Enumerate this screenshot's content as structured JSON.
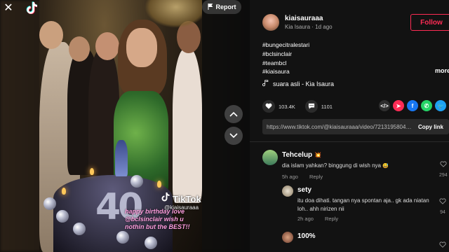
{
  "window": {
    "close_icon": "close-icon",
    "logo_icon": "tiktok-logo-icon"
  },
  "report": {
    "label": "Report",
    "icon": "flag-icon"
  },
  "video": {
    "overlay_brand": "TikTok",
    "overlay_handle": "@kiaisauraaa",
    "overlay_caption": "happy birthday love @bclsinclair wish u nothin but the BEST!!",
    "cake_number": "40"
  },
  "nav": {
    "prev_icon": "chevron-up-icon",
    "next_icon": "chevron-down-icon"
  },
  "author": {
    "username": "kiaisauraaa",
    "display_name": "Kia Isaura",
    "posted": "1d ago",
    "follow_label": "Follow"
  },
  "hashtags": [
    "#bungecitralestari",
    "#bclsinclair",
    "#teambcl",
    "#kiaisaura"
  ],
  "more_label": "more",
  "sound": {
    "icon": "music-note-icon",
    "label": "suara asli - Kia Isaura"
  },
  "stats": {
    "likes": "103.4K",
    "comments": "1101"
  },
  "share": [
    {
      "icon": "embed-icon",
      "glyph": "</>",
      "color": "#2f2f2f"
    },
    {
      "icon": "send-icon",
      "glyph": "➤",
      "color": "#fe2c55"
    },
    {
      "icon": "facebook-icon",
      "glyph": "f",
      "color": "#1877f2"
    },
    {
      "icon": "whatsapp-icon",
      "glyph": "✆",
      "color": "#25d366"
    },
    {
      "icon": "twitter-icon",
      "glyph": "🐦",
      "color": "#1da1f2"
    },
    {
      "icon": "share-icon",
      "glyph": "↪",
      "color": "#2f2f2f"
    }
  ],
  "share_url": "https://www.tiktok.com/@kiaisauraaa/video/7213195804184...",
  "copy_link_label": "Copy link",
  "comments": [
    {
      "name": "Tehcelup",
      "badge": "💥",
      "text": "dia islam yahkan? binggung di wish nya",
      "emoji": "😅",
      "time": "5h ago",
      "reply_label": "Reply",
      "likes": "294"
    },
    {
      "name": "sety",
      "text": "itu doa dihati. tangan nya spontan aja.. gk ada niatan loh.. ahh nirizen nii",
      "time": "2h ago",
      "reply_label": "Reply",
      "likes": "94"
    },
    {
      "name": "100%",
      "text": "",
      "likes": ""
    }
  ]
}
